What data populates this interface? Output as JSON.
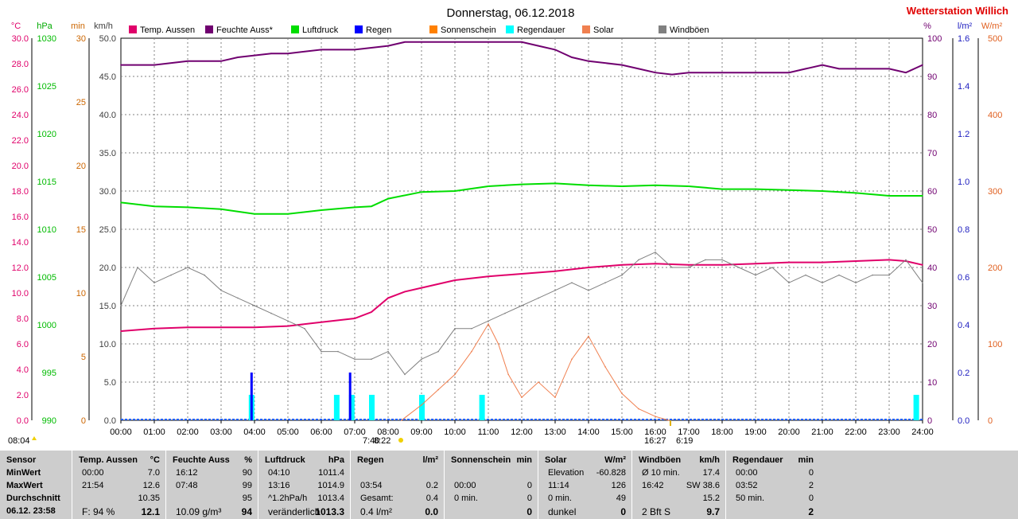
{
  "title": "Donnerstag, 06.12.2018",
  "station": "Wetterstation Willich",
  "colors": {
    "temp": "#e0006a",
    "humidity": "#700070",
    "pressure": "#00dd00",
    "rain": "#0000ff",
    "sunshine": "#ff8000",
    "rain_duration": "#00ffff",
    "solar": "#f08050",
    "gusts": "#808080",
    "grid": "#808080"
  },
  "legend": [
    {
      "label": "Temp. Aussen",
      "color": "#e0006a"
    },
    {
      "label": "Feuchte Auss*",
      "color": "#700070"
    },
    {
      "label": "Luftdruck",
      "color": "#00dd00"
    },
    {
      "label": "Regen",
      "color": "#0000ff"
    },
    {
      "label": "Sonnenschein",
      "color": "#ff8000"
    },
    {
      "label": "Regendauer",
      "color": "#00ffff"
    },
    {
      "label": "Solar",
      "color": "#f08050"
    },
    {
      "label": "Windböen",
      "color": "#808080"
    }
  ],
  "axis_units": {
    "temp": "°C",
    "pressure": "hPa",
    "sun_min": "min",
    "wind": "km/h",
    "humidity": "%",
    "rain": "l/m²",
    "solar": "W/m²"
  },
  "sun_markers": {
    "sunrise": "08:04",
    "first_sun": "8:22",
    "sunset": "16:27",
    "sun_duration": "6:19",
    "first_rain": "7:40"
  },
  "chart_data": {
    "type": "line",
    "x_ticks": [
      "00:00",
      "01:00",
      "02:00",
      "03:00",
      "04:00",
      "05:00",
      "06:00",
      "07:00",
      "08:00",
      "09:00",
      "10:00",
      "11:00",
      "12:00",
      "13:00",
      "14:00",
      "15:00",
      "16:00",
      "17:00",
      "18:00",
      "19:00",
      "20:00",
      "21:00",
      "22:00",
      "23:00",
      "24:00"
    ],
    "y_axes": {
      "temp_c": {
        "ticks": [
          "30.0",
          "28.0",
          "26.0",
          "24.0",
          "22.0",
          "20.0",
          "18.0",
          "16.0",
          "14.0",
          "12.0",
          "10.0",
          "8.0",
          "6.0",
          "4.0",
          "2.0",
          "0.0"
        ],
        "range": [
          0,
          30
        ]
      },
      "pressure_hpa": {
        "ticks": [
          "1030",
          "1025",
          "1020",
          "1015",
          "1010",
          "1005",
          "1000",
          "995",
          "990"
        ],
        "range": [
          990,
          1030
        ]
      },
      "sunshine_min": {
        "ticks": [
          "30",
          "25",
          "20",
          "15",
          "10",
          "5",
          "0"
        ],
        "range": [
          0,
          30
        ]
      },
      "wind_kmh": {
        "ticks": [
          "50.0",
          "45.0",
          "40.0",
          "35.0",
          "30.0",
          "25.0",
          "20.0",
          "15.0",
          "10.0",
          "5.0",
          "0.0"
        ],
        "range": [
          0,
          50
        ]
      },
      "humidity_pct": {
        "ticks": [
          "100",
          "90",
          "80",
          "70",
          "60",
          "50",
          "40",
          "30",
          "20",
          "10",
          "0"
        ],
        "range": [
          0,
          100
        ]
      },
      "rain_lm2": {
        "ticks": [
          "1.6",
          "1.4",
          "1.2",
          "1.0",
          "0.8",
          "0.6",
          "0.4",
          "0.2",
          "0.0"
        ],
        "range": [
          0,
          1.6
        ]
      },
      "solar_wm2": {
        "ticks": [
          "500",
          "400",
          "300",
          "200",
          "100",
          "0"
        ],
        "range": [
          0,
          500
        ]
      }
    },
    "series": [
      {
        "name": "Temp. Aussen",
        "axis": "temp_c",
        "x": [
          0,
          1,
          2,
          3,
          4,
          5,
          6,
          7,
          7.5,
          8,
          8.5,
          9,
          10,
          11,
          12,
          13,
          14,
          15,
          16,
          17,
          18,
          19,
          20,
          21,
          22,
          23,
          23.5,
          24
        ],
        "values": [
          7.0,
          7.2,
          7.3,
          7.3,
          7.3,
          7.4,
          7.7,
          8.0,
          8.5,
          9.6,
          10.1,
          10.4,
          11.0,
          11.3,
          11.5,
          11.7,
          12.0,
          12.2,
          12.3,
          12.2,
          12.2,
          12.3,
          12.4,
          12.4,
          12.5,
          12.6,
          12.5,
          12.2
        ]
      },
      {
        "name": "Feuchte Auss*",
        "axis": "humidity_pct",
        "x": [
          0,
          1,
          2,
          3,
          3.5,
          4,
          4.5,
          5,
          6,
          7,
          8,
          8.5,
          9,
          10,
          11,
          12,
          12.5,
          13,
          13.5,
          14,
          15,
          15.5,
          16,
          16.5,
          17,
          18,
          19,
          20,
          20.5,
          21,
          21.5,
          22,
          23,
          23.5,
          24
        ],
        "values": [
          93,
          93,
          94,
          94,
          95,
          95.5,
          96,
          96,
          97,
          97,
          98,
          99,
          99,
          99,
          99,
          99,
          98,
          97,
          95,
          94,
          93,
          92,
          91,
          90.5,
          91,
          91,
          91,
          91,
          92,
          93,
          92,
          92,
          92,
          91,
          93
        ]
      },
      {
        "name": "Luftdruck",
        "axis": "pressure_hpa",
        "x": [
          0,
          1,
          2,
          3,
          4,
          5,
          6,
          7,
          7.5,
          8,
          9,
          10,
          11,
          12,
          13,
          14,
          15,
          16,
          17,
          18,
          19,
          20,
          21,
          22,
          23,
          24
        ],
        "values": [
          1012.8,
          1012.4,
          1012.3,
          1012.1,
          1011.6,
          1011.6,
          1012.0,
          1012.3,
          1012.4,
          1013.2,
          1013.9,
          1014.0,
          1014.5,
          1014.7,
          1014.8,
          1014.6,
          1014.5,
          1014.6,
          1014.5,
          1014.2,
          1014.2,
          1014.1,
          1014.0,
          1013.8,
          1013.5,
          1013.5
        ]
      },
      {
        "name": "Windböen",
        "axis": "wind_kmh",
        "x": [
          0,
          0.5,
          1,
          1.5,
          2,
          2.5,
          3,
          3.5,
          4,
          4.5,
          5,
          5.5,
          6,
          6.5,
          7,
          7.5,
          8,
          8.5,
          9,
          9.5,
          10,
          10.5,
          11,
          11.5,
          12,
          12.5,
          13,
          13.5,
          14,
          14.5,
          15,
          15.5,
          16,
          16.5,
          17,
          17.5,
          18,
          18.5,
          19,
          19.5,
          20,
          20.5,
          21,
          21.5,
          22,
          22.5,
          23,
          23.5,
          24
        ],
        "values": [
          15,
          20,
          18,
          19,
          20,
          19,
          17,
          16,
          15,
          14,
          13,
          12,
          9,
          9,
          8,
          8,
          9,
          6,
          8,
          9,
          12,
          12,
          13,
          14,
          15,
          16,
          17,
          18,
          17,
          18,
          19,
          21,
          22,
          20,
          20,
          21,
          21,
          20,
          19,
          20,
          18,
          19,
          18,
          19,
          18,
          19,
          19,
          21,
          18
        ]
      },
      {
        "name": "Solar",
        "axis": "solar_wm2",
        "x": [
          8.4,
          9,
          9.5,
          10,
          10.5,
          11,
          11.3,
          11.6,
          12,
          12.5,
          13,
          13.5,
          14,
          14.5,
          15,
          15.5,
          16,
          16.4
        ],
        "values": [
          0,
          20,
          40,
          60,
          90,
          126,
          100,
          60,
          30,
          50,
          30,
          80,
          110,
          70,
          35,
          15,
          5,
          0
        ]
      }
    ],
    "rain_bars": [
      {
        "time": 3.9,
        "value": 0.2
      },
      {
        "time": 6.85,
        "value": 0.2
      }
    ],
    "rain_duration_bars": [
      {
        "time": 3.9,
        "value": 2
      },
      {
        "time": 6.45,
        "value": 2
      },
      {
        "time": 6.9,
        "value": 2
      },
      {
        "time": 7.5,
        "value": 2
      },
      {
        "time": 9.0,
        "value": 2
      },
      {
        "time": 10.8,
        "value": 2
      },
      {
        "time": 23.8,
        "value": 2
      }
    ]
  },
  "stats": {
    "sensor": {
      "header": "Sensor",
      "rows": [
        "MinWert",
        "MaxWert",
        "Durchschnitt",
        "06.12. 23:58"
      ]
    },
    "temp": {
      "header": "Temp. Aussen",
      "unit": "°C",
      "rows": [
        [
          "00:00",
          "7.0"
        ],
        [
          "21:54",
          "12.6"
        ],
        [
          "",
          "10.35"
        ],
        [
          "F: 94 %",
          "12.1"
        ]
      ]
    },
    "humidity": {
      "header": "Feuchte Auss",
      "unit": "%",
      "rows": [
        [
          "16:12",
          "90"
        ],
        [
          "07:48",
          "99"
        ],
        [
          "",
          "95"
        ],
        [
          "10.09 g/m³",
          "94"
        ]
      ]
    },
    "pressure": {
      "header": "Luftdruck",
      "unit": "hPa",
      "rows": [
        [
          "04:10",
          "1011.4"
        ],
        [
          "13:16",
          "1014.9"
        ],
        [
          "^1.2hPa/h",
          "1013.4"
        ],
        [
          "veränderlich",
          "1013.3"
        ]
      ]
    },
    "rain": {
      "header": "Regen",
      "unit": "l/m²",
      "rows": [
        [
          "",
          ""
        ],
        [
          "03:54",
          "0.2"
        ],
        [
          "Gesamt:",
          "0.4"
        ],
        [
          "0.4 l/m²",
          "0.0"
        ]
      ]
    },
    "sunshine": {
      "header": "Sonnenschein",
      "unit": "min",
      "rows": [
        [
          "",
          ""
        ],
        [
          "00:00",
          "0"
        ],
        [
          "0 min.",
          "0"
        ],
        [
          "",
          "0"
        ]
      ]
    },
    "solar": {
      "header": "Solar",
      "unit": "W/m²",
      "rows": [
        [
          "Elevation",
          "-60.828"
        ],
        [
          "11:14",
          "126"
        ],
        [
          "0 min.",
          "49"
        ],
        [
          "dunkel",
          "0"
        ]
      ]
    },
    "wind": {
      "header": "Windböen",
      "unit": "km/h",
      "rows": [
        [
          "Ø 10 min.",
          "17.4"
        ],
        [
          "16:42",
          "SW 38.6"
        ],
        [
          "",
          "15.2"
        ],
        [
          "2 Bft S",
          "9.7"
        ]
      ]
    },
    "rain_duration": {
      "header": "Regendauer",
      "unit": "min",
      "rows": [
        [
          "00:00",
          "0"
        ],
        [
          "03:52",
          "2"
        ],
        [
          "50 min.",
          "0"
        ],
        [
          "",
          "2"
        ]
      ]
    }
  }
}
